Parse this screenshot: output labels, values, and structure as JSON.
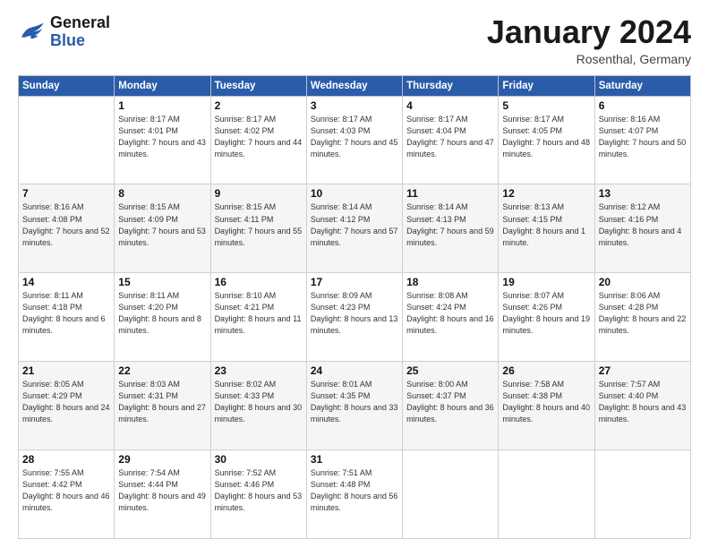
{
  "logo": {
    "line1": "General",
    "line2": "Blue"
  },
  "title": "January 2024",
  "location": "Rosenthal, Germany",
  "days_header": [
    "Sunday",
    "Monday",
    "Tuesday",
    "Wednesday",
    "Thursday",
    "Friday",
    "Saturday"
  ],
  "weeks": [
    [
      {
        "day": "",
        "sunrise": "",
        "sunset": "",
        "daylight": ""
      },
      {
        "day": "1",
        "sunrise": "Sunrise: 8:17 AM",
        "sunset": "Sunset: 4:01 PM",
        "daylight": "Daylight: 7 hours and 43 minutes."
      },
      {
        "day": "2",
        "sunrise": "Sunrise: 8:17 AM",
        "sunset": "Sunset: 4:02 PM",
        "daylight": "Daylight: 7 hours and 44 minutes."
      },
      {
        "day": "3",
        "sunrise": "Sunrise: 8:17 AM",
        "sunset": "Sunset: 4:03 PM",
        "daylight": "Daylight: 7 hours and 45 minutes."
      },
      {
        "day": "4",
        "sunrise": "Sunrise: 8:17 AM",
        "sunset": "Sunset: 4:04 PM",
        "daylight": "Daylight: 7 hours and 47 minutes."
      },
      {
        "day": "5",
        "sunrise": "Sunrise: 8:17 AM",
        "sunset": "Sunset: 4:05 PM",
        "daylight": "Daylight: 7 hours and 48 minutes."
      },
      {
        "day": "6",
        "sunrise": "Sunrise: 8:16 AM",
        "sunset": "Sunset: 4:07 PM",
        "daylight": "Daylight: 7 hours and 50 minutes."
      }
    ],
    [
      {
        "day": "7",
        "sunrise": "Sunrise: 8:16 AM",
        "sunset": "Sunset: 4:08 PM",
        "daylight": "Daylight: 7 hours and 52 minutes."
      },
      {
        "day": "8",
        "sunrise": "Sunrise: 8:15 AM",
        "sunset": "Sunset: 4:09 PM",
        "daylight": "Daylight: 7 hours and 53 minutes."
      },
      {
        "day": "9",
        "sunrise": "Sunrise: 8:15 AM",
        "sunset": "Sunset: 4:11 PM",
        "daylight": "Daylight: 7 hours and 55 minutes."
      },
      {
        "day": "10",
        "sunrise": "Sunrise: 8:14 AM",
        "sunset": "Sunset: 4:12 PM",
        "daylight": "Daylight: 7 hours and 57 minutes."
      },
      {
        "day": "11",
        "sunrise": "Sunrise: 8:14 AM",
        "sunset": "Sunset: 4:13 PM",
        "daylight": "Daylight: 7 hours and 59 minutes."
      },
      {
        "day": "12",
        "sunrise": "Sunrise: 8:13 AM",
        "sunset": "Sunset: 4:15 PM",
        "daylight": "Daylight: 8 hours and 1 minute."
      },
      {
        "day": "13",
        "sunrise": "Sunrise: 8:12 AM",
        "sunset": "Sunset: 4:16 PM",
        "daylight": "Daylight: 8 hours and 4 minutes."
      }
    ],
    [
      {
        "day": "14",
        "sunrise": "Sunrise: 8:11 AM",
        "sunset": "Sunset: 4:18 PM",
        "daylight": "Daylight: 8 hours and 6 minutes."
      },
      {
        "day": "15",
        "sunrise": "Sunrise: 8:11 AM",
        "sunset": "Sunset: 4:20 PM",
        "daylight": "Daylight: 8 hours and 8 minutes."
      },
      {
        "day": "16",
        "sunrise": "Sunrise: 8:10 AM",
        "sunset": "Sunset: 4:21 PM",
        "daylight": "Daylight: 8 hours and 11 minutes."
      },
      {
        "day": "17",
        "sunrise": "Sunrise: 8:09 AM",
        "sunset": "Sunset: 4:23 PM",
        "daylight": "Daylight: 8 hours and 13 minutes."
      },
      {
        "day": "18",
        "sunrise": "Sunrise: 8:08 AM",
        "sunset": "Sunset: 4:24 PM",
        "daylight": "Daylight: 8 hours and 16 minutes."
      },
      {
        "day": "19",
        "sunrise": "Sunrise: 8:07 AM",
        "sunset": "Sunset: 4:26 PM",
        "daylight": "Daylight: 8 hours and 19 minutes."
      },
      {
        "day": "20",
        "sunrise": "Sunrise: 8:06 AM",
        "sunset": "Sunset: 4:28 PM",
        "daylight": "Daylight: 8 hours and 22 minutes."
      }
    ],
    [
      {
        "day": "21",
        "sunrise": "Sunrise: 8:05 AM",
        "sunset": "Sunset: 4:29 PM",
        "daylight": "Daylight: 8 hours and 24 minutes."
      },
      {
        "day": "22",
        "sunrise": "Sunrise: 8:03 AM",
        "sunset": "Sunset: 4:31 PM",
        "daylight": "Daylight: 8 hours and 27 minutes."
      },
      {
        "day": "23",
        "sunrise": "Sunrise: 8:02 AM",
        "sunset": "Sunset: 4:33 PM",
        "daylight": "Daylight: 8 hours and 30 minutes."
      },
      {
        "day": "24",
        "sunrise": "Sunrise: 8:01 AM",
        "sunset": "Sunset: 4:35 PM",
        "daylight": "Daylight: 8 hours and 33 minutes."
      },
      {
        "day": "25",
        "sunrise": "Sunrise: 8:00 AM",
        "sunset": "Sunset: 4:37 PM",
        "daylight": "Daylight: 8 hours and 36 minutes."
      },
      {
        "day": "26",
        "sunrise": "Sunrise: 7:58 AM",
        "sunset": "Sunset: 4:38 PM",
        "daylight": "Daylight: 8 hours and 40 minutes."
      },
      {
        "day": "27",
        "sunrise": "Sunrise: 7:57 AM",
        "sunset": "Sunset: 4:40 PM",
        "daylight": "Daylight: 8 hours and 43 minutes."
      }
    ],
    [
      {
        "day": "28",
        "sunrise": "Sunrise: 7:55 AM",
        "sunset": "Sunset: 4:42 PM",
        "daylight": "Daylight: 8 hours and 46 minutes."
      },
      {
        "day": "29",
        "sunrise": "Sunrise: 7:54 AM",
        "sunset": "Sunset: 4:44 PM",
        "daylight": "Daylight: 8 hours and 49 minutes."
      },
      {
        "day": "30",
        "sunrise": "Sunrise: 7:52 AM",
        "sunset": "Sunset: 4:46 PM",
        "daylight": "Daylight: 8 hours and 53 minutes."
      },
      {
        "day": "31",
        "sunrise": "Sunrise: 7:51 AM",
        "sunset": "Sunset: 4:48 PM",
        "daylight": "Daylight: 8 hours and 56 minutes."
      },
      {
        "day": "",
        "sunrise": "",
        "sunset": "",
        "daylight": ""
      },
      {
        "day": "",
        "sunrise": "",
        "sunset": "",
        "daylight": ""
      },
      {
        "day": "",
        "sunrise": "",
        "sunset": "",
        "daylight": ""
      }
    ]
  ]
}
